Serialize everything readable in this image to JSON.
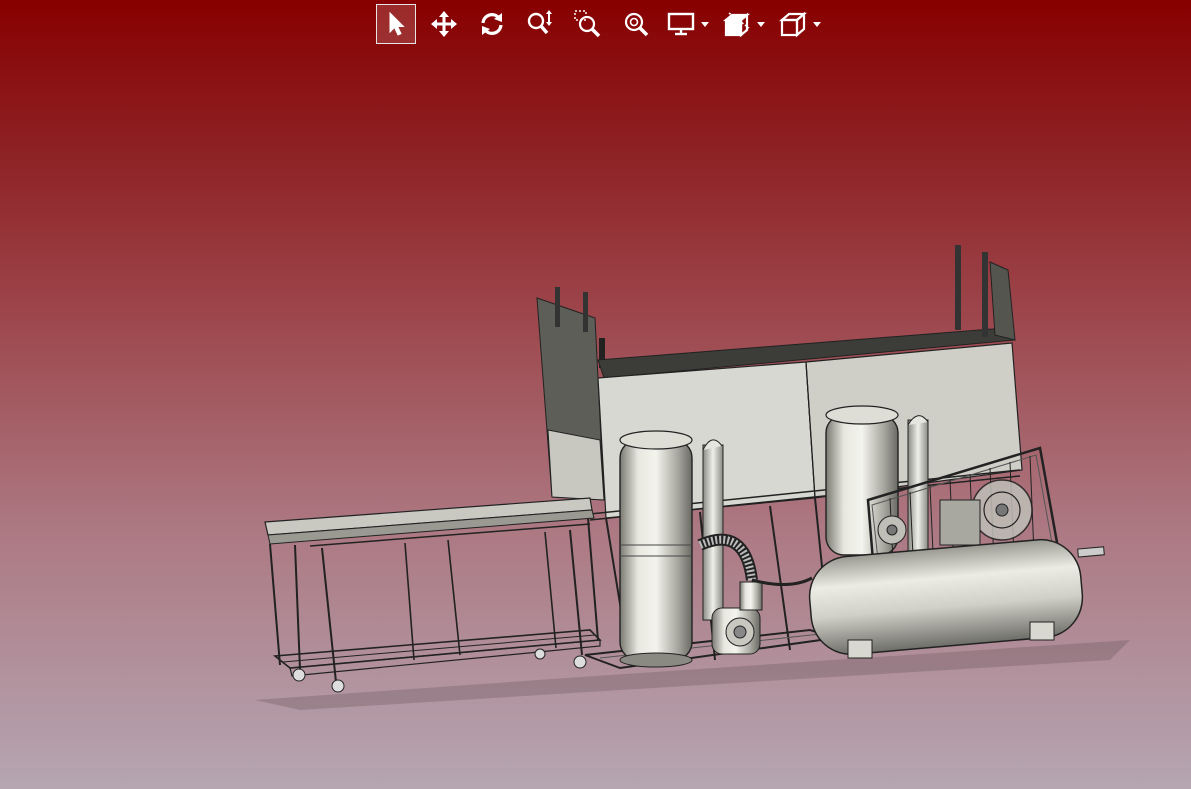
{
  "app": {
    "view": "3d-model-viewer"
  },
  "colors": {
    "background_top": "#880000",
    "background_bottom": "#b5a6b2",
    "icon": "#ffffff",
    "active_border": "#e6e6e6"
  },
  "toolbar": {
    "tools": [
      {
        "id": "select",
        "icon": "cursor-arrow-icon",
        "active": true
      },
      {
        "id": "pan",
        "icon": "move-arrows-icon",
        "active": false
      },
      {
        "id": "rotate",
        "icon": "rotate-icon",
        "active": false
      },
      {
        "id": "zoom",
        "icon": "zoom-updown-icon",
        "active": false
      },
      {
        "id": "zoom-window",
        "icon": "zoom-window-icon",
        "active": false
      },
      {
        "id": "zoom-fit",
        "icon": "zoom-fit-icon",
        "active": false
      },
      {
        "id": "display-mode",
        "icon": "monitor-icon",
        "has_dropdown": true
      },
      {
        "id": "section-view",
        "icon": "section-cube-icon",
        "has_dropdown": true
      },
      {
        "id": "standard-views",
        "icon": "iso-cube-icon",
        "has_dropdown": true
      }
    ]
  },
  "model": {
    "components": [
      "rolling-table",
      "enclosure-cabinet",
      "cyclone-filter-tanks",
      "blower-motor",
      "air-compressor"
    ]
  }
}
